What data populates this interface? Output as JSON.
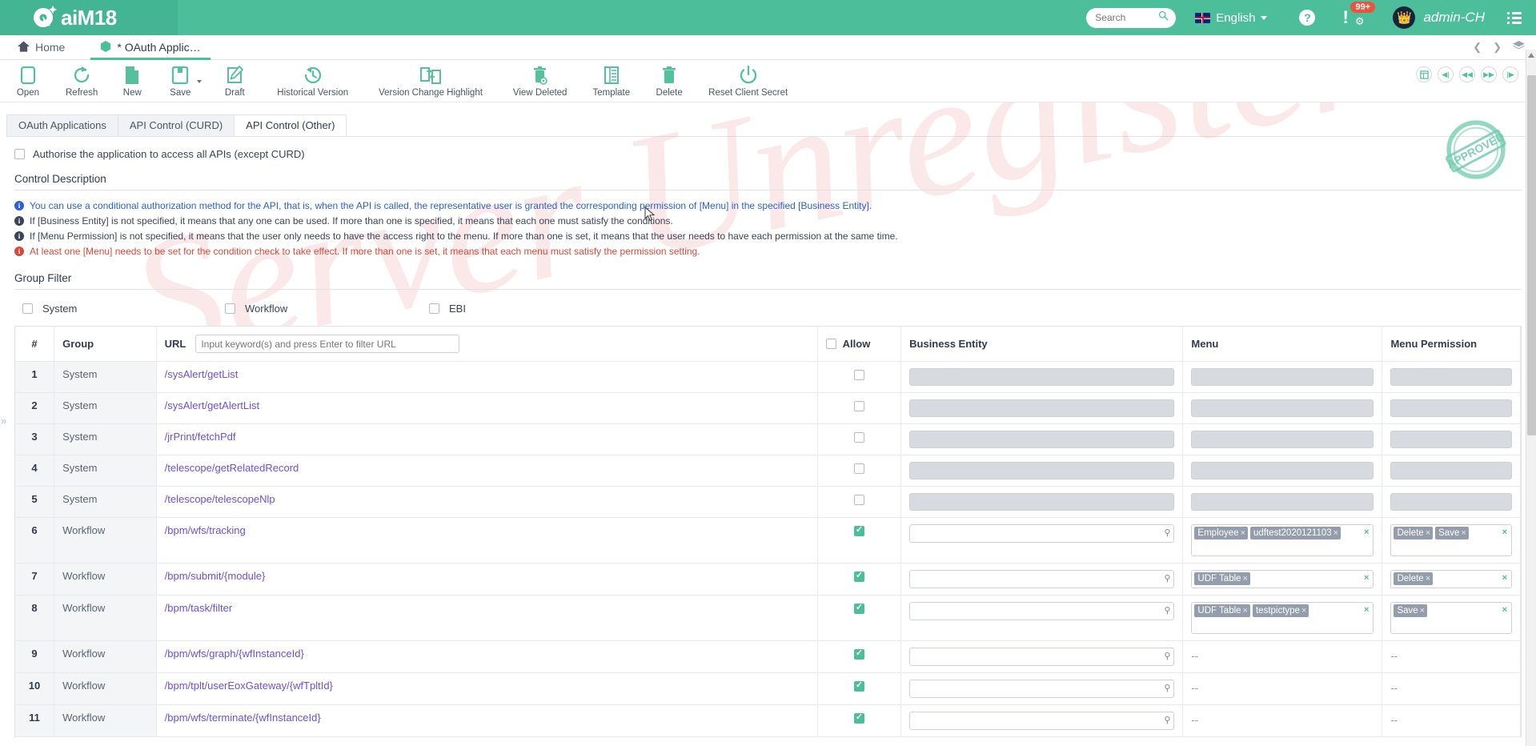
{
  "brand": {
    "name": "aiM18",
    "logo_icon": "aim-logo-icon"
  },
  "header": {
    "search": {
      "placeholder": "Search",
      "value": "",
      "icon": "search-icon"
    },
    "language": {
      "label": "English",
      "flag": "uk-flag-icon",
      "caret": "chevron-down-icon"
    },
    "help_icon": "help-icon",
    "alert": {
      "icon": "alert-exclamation-icon",
      "badge": "99+",
      "gear_icon": "gear-icon"
    },
    "user": {
      "name": "admin-CH",
      "avatar": "avatar-icon"
    },
    "menu_icon": "list-menu-icon"
  },
  "tabs": {
    "items": [
      {
        "label": "Home",
        "icon": "home-icon",
        "active": false
      },
      {
        "label": "* OAuth Applic…",
        "icon": "cube-icon",
        "active": true
      }
    ],
    "nav": {
      "prev_icon": "chevron-left-icon",
      "next_icon": "chevron-right-icon",
      "layers_icon": "layers-icon"
    }
  },
  "toolbar": {
    "items": [
      {
        "label": "Open",
        "icon": "open-window-icon",
        "caret": false
      },
      {
        "label": "Refresh",
        "icon": "refresh-icon",
        "caret": false
      },
      {
        "label": "New",
        "icon": "new-document-icon",
        "caret": false
      },
      {
        "label": "Save",
        "icon": "save-floppy-icon",
        "caret": true
      },
      {
        "label": "Draft",
        "icon": "draft-pencil-icon",
        "caret": false
      },
      {
        "label": "Historical Version",
        "icon": "history-clock-icon",
        "caret": false
      },
      {
        "label": "Version Change Highlight",
        "icon": "version-compare-icon",
        "caret": false
      },
      {
        "label": "View Deleted",
        "icon": "trash-view-icon",
        "caret": false
      },
      {
        "label": "Template",
        "icon": "template-icon",
        "caret": false
      },
      {
        "label": "Delete",
        "icon": "trash-icon",
        "caret": false
      },
      {
        "label": "Reset Client Secret",
        "icon": "power-reset-icon",
        "caret": false
      }
    ],
    "pager": [
      {
        "icon": "layout-panel-icon"
      },
      {
        "icon": "first-record-icon"
      },
      {
        "icon": "prev-record-icon"
      },
      {
        "icon": "next-record-icon"
      },
      {
        "icon": "last-record-icon"
      }
    ]
  },
  "subtabs": [
    {
      "label": "OAuth Applications",
      "active": false
    },
    {
      "label": "API Control (CURD)",
      "active": false
    },
    {
      "label": "API Control (Other)",
      "active": true
    }
  ],
  "authorise": {
    "label": "Authorise the application to access all APIs (except CURD)",
    "checked": false
  },
  "control_description": {
    "title": "Control Description",
    "lines": [
      {
        "tone": "blue",
        "text": "You can use a conditional authorization method for the API, that is, when the API is called, the representative user is granted the corresponding permission of [Menu] in the specified [Business Entity]."
      },
      {
        "tone": "dark",
        "text": "If [Business Entity] is not specified, it means that any one can be used. If more than one is specified, it means that each one must satisfy the conditions."
      },
      {
        "tone": "dark",
        "text": "If [Menu Permission] is not specified, it means that the user only needs to have the access right to the menu. If more than one is set, it means that the user needs to have each permission at the same time."
      },
      {
        "tone": "red",
        "text": "At least one [Menu] needs to be set for the condition check to take effect. If more than one is set, it means that each menu must satisfy the permission setting."
      }
    ]
  },
  "group_filter": {
    "title": "Group Filter",
    "options": [
      {
        "label": "System",
        "checked": false
      },
      {
        "label": "Workflow",
        "checked": false
      },
      {
        "label": "EBI",
        "checked": false
      }
    ]
  },
  "table": {
    "headers": {
      "index": "#",
      "group": "Group",
      "url": "URL",
      "url_filter_placeholder": "Input keyword(s) and press Enter to filter URL",
      "url_filter_value": "",
      "allow": "Allow",
      "allow_checked": false,
      "business_entity": "Business Entity",
      "menu": "Menu",
      "menu_permission": "Menu Permission"
    },
    "rows": [
      {
        "index": "1",
        "group": "System",
        "url": "/sysAlert/getList",
        "allow": false,
        "be_mode": "readonly",
        "menu_mode": "readonly",
        "mp_mode": "readonly",
        "menu_tags": [],
        "mp_tags": [],
        "tall": false
      },
      {
        "index": "2",
        "group": "System",
        "url": "/sysAlert/getAlertList",
        "allow": false,
        "be_mode": "readonly",
        "menu_mode": "readonly",
        "mp_mode": "readonly",
        "menu_tags": [],
        "mp_tags": [],
        "tall": false
      },
      {
        "index": "3",
        "group": "System",
        "url": "/jrPrint/fetchPdf",
        "allow": false,
        "be_mode": "readonly",
        "menu_mode": "readonly",
        "mp_mode": "readonly",
        "menu_tags": [],
        "mp_tags": [],
        "tall": false
      },
      {
        "index": "4",
        "group": "System",
        "url": "/telescope/getRelatedRecord",
        "allow": false,
        "be_mode": "readonly",
        "menu_mode": "readonly",
        "mp_mode": "readonly",
        "menu_tags": [],
        "mp_tags": [],
        "tall": false
      },
      {
        "index": "5",
        "group": "System",
        "url": "/telescope/telescopeNlp",
        "allow": false,
        "be_mode": "readonly",
        "menu_mode": "readonly",
        "mp_mode": "readonly",
        "menu_tags": [],
        "mp_tags": [],
        "tall": false
      },
      {
        "index": "6",
        "group": "Workflow",
        "url": "/bpm/wfs/tracking",
        "allow": true,
        "be_mode": "input",
        "menu_mode": "tags",
        "mp_mode": "tags",
        "menu_tags": [
          "Employee",
          "udftest2020121103"
        ],
        "mp_tags": [
          "Delete",
          "Save"
        ],
        "tall": true
      },
      {
        "index": "7",
        "group": "Workflow",
        "url": "/bpm/submit/{module}",
        "allow": true,
        "be_mode": "input",
        "menu_mode": "tags",
        "mp_mode": "tags",
        "menu_tags": [
          "UDF Table"
        ],
        "mp_tags": [
          "Delete"
        ],
        "tall": false
      },
      {
        "index": "8",
        "group": "Workflow",
        "url": "/bpm/task/filter",
        "allow": true,
        "be_mode": "input",
        "menu_mode": "tags",
        "mp_mode": "tags",
        "menu_tags": [
          "UDF Table",
          "testpictype"
        ],
        "mp_tags": [
          "Save"
        ],
        "tall": true
      },
      {
        "index": "9",
        "group": "Workflow",
        "url": "/bpm/wfs/graph/{wfInstanceId}",
        "allow": true,
        "be_mode": "input",
        "menu_mode": "dash",
        "mp_mode": "dash",
        "menu_tags": [],
        "mp_tags": [],
        "tall": false
      },
      {
        "index": "10",
        "group": "Workflow",
        "url": "/bpm/tplt/userEoxGateway/{wfTpltId}",
        "allow": true,
        "be_mode": "input",
        "menu_mode": "dash",
        "mp_mode": "dash",
        "menu_tags": [],
        "mp_tags": [],
        "tall": false
      },
      {
        "index": "11",
        "group": "Workflow",
        "url": "/bpm/wfs/terminate/{wfInstanceId}",
        "allow": true,
        "be_mode": "input",
        "menu_mode": "dash",
        "mp_mode": "dash",
        "menu_tags": [],
        "mp_tags": [],
        "tall": false
      }
    ],
    "dash_text": "--"
  },
  "stamp": {
    "text": "APPROVED",
    "icon": "approved-stamp-icon"
  },
  "watermark": {
    "text": "Server Unregistered"
  },
  "colors": {
    "brand_green": "#4cbf9a",
    "link_purple": "#6b4fe0",
    "info_blue": "#2a5fd6",
    "warn_red": "#d9483b",
    "tag_gray": "#939dab"
  }
}
